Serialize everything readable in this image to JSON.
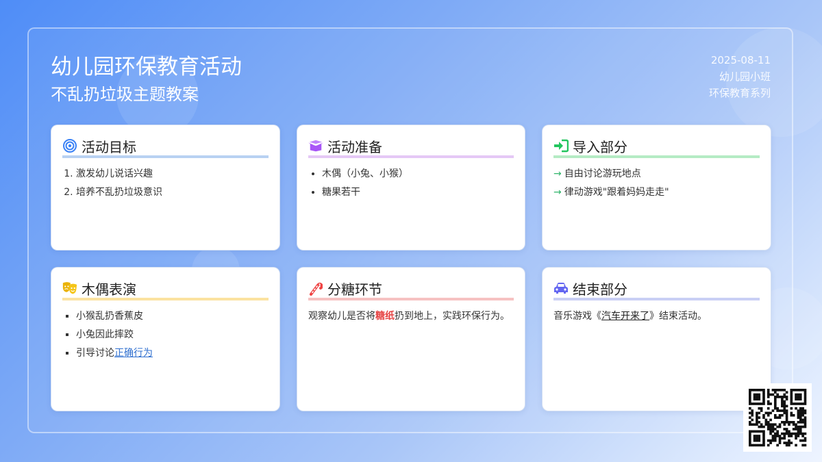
{
  "header": {
    "title": "幼儿园环保教育活动",
    "subtitle": "不乱扔垃圾主题教案",
    "date": "2025-08-11",
    "class_name": "幼儿园小班",
    "series": "环保教育系列"
  },
  "cards": {
    "goals": {
      "title": "活动目标",
      "icon": "target-icon",
      "accent": "#b8d1f2",
      "items": [
        "激发幼儿说话兴趣",
        "培养不乱扔垃圾意识"
      ]
    },
    "prep": {
      "title": "活动准备",
      "icon": "box-open-icon",
      "accent": "#e5c8f6",
      "items": [
        "木偶（小兔、小猴）",
        "糖果若干"
      ]
    },
    "intro": {
      "title": "导入部分",
      "icon": "sign-in-icon",
      "accent": "#b5ebc4",
      "items": [
        "自由讨论游玩地点",
        "律动游戏\"跟着妈妈走走\""
      ]
    },
    "puppet": {
      "title": "木偶表演",
      "icon": "theater-masks-icon",
      "accent": "#fbe2a0",
      "items": [
        "小猴乱扔香蕉皮",
        "小兔因此摔跤"
      ],
      "item3_prefix": "引导讨论",
      "item3_link": "正确行为"
    },
    "candy": {
      "title": "分糖环节",
      "icon": "candy-cane-icon",
      "accent": "#f6c2c2",
      "text_before": "观察幼儿是否将",
      "text_highlight": "糖纸",
      "text_after": "扔到地上，实践环保行为。"
    },
    "ending": {
      "title": "结束部分",
      "icon": "car-icon",
      "accent": "#c9cff5",
      "text_before": "音乐游戏《",
      "text_link": "汽车开来了",
      "text_after": "》结束活动。"
    }
  },
  "colors": {
    "target": "#3b82f6",
    "box": "#a855f7",
    "signin": "#22c55e",
    "masks": "#eab308",
    "candy": "#ef4444",
    "car": "#6366f1"
  }
}
